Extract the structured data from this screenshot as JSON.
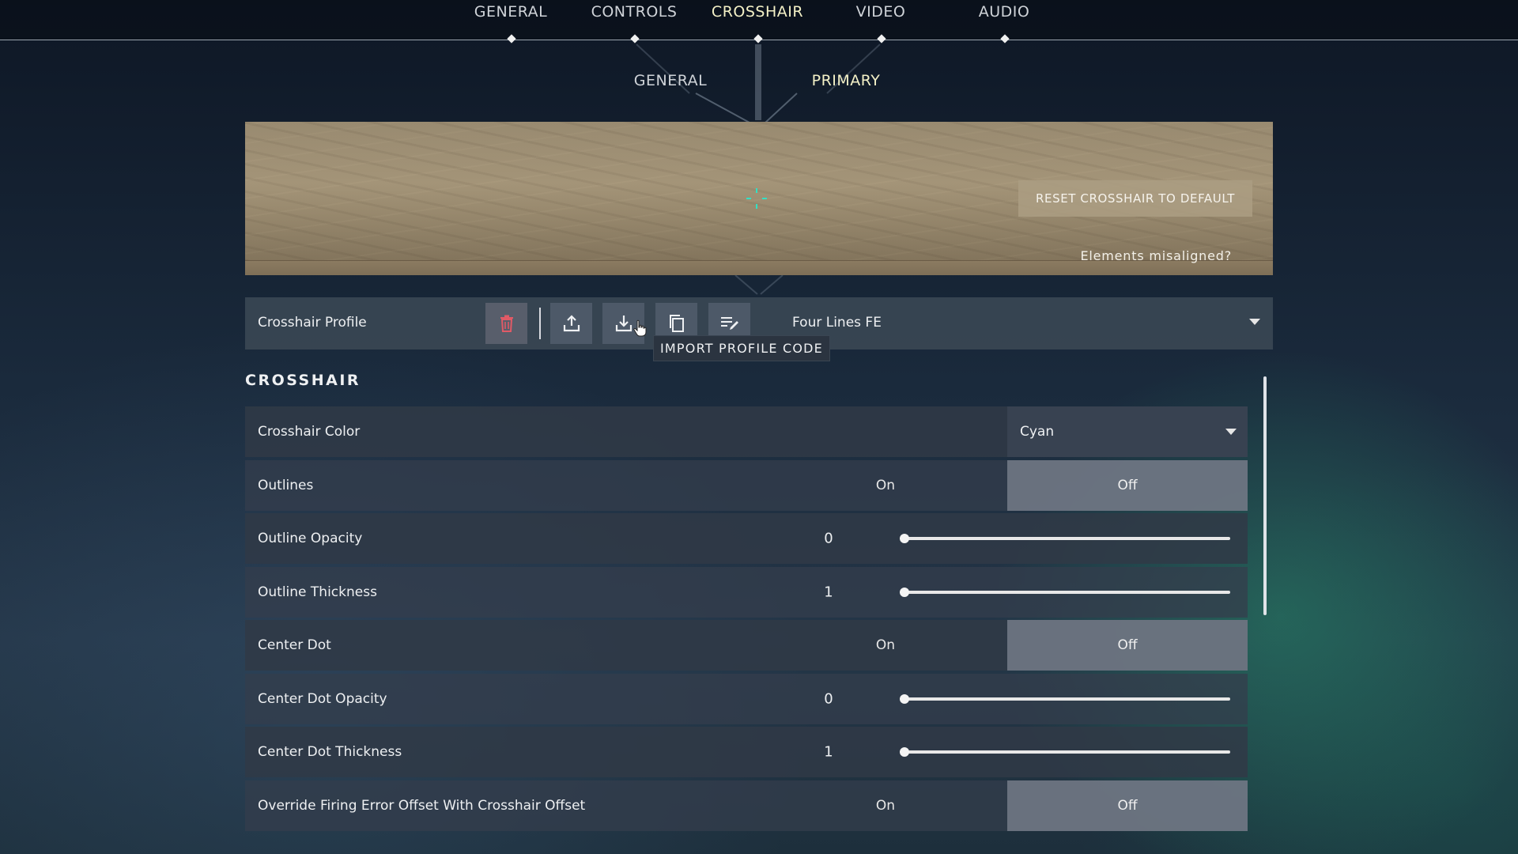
{
  "nav": {
    "tabs": [
      {
        "label": "GENERAL",
        "active": false
      },
      {
        "label": "CONTROLS",
        "active": false
      },
      {
        "label": "CROSSHAIR",
        "active": true
      },
      {
        "label": "VIDEO",
        "active": false
      },
      {
        "label": "AUDIO",
        "active": false
      }
    ]
  },
  "subnav": {
    "tabs": [
      {
        "label": "GENERAL",
        "active": false
      },
      {
        "label": "PRIMARY",
        "active": true
      }
    ]
  },
  "preview": {
    "reset_label": "RESET CROSSHAIR TO DEFAULT",
    "misaligned_label": "Elements misaligned?",
    "crosshair_color": "#32e0c4"
  },
  "profile": {
    "label": "Crosshair Profile",
    "selected": "Four Lines FE",
    "tooltip": "IMPORT PROFILE CODE",
    "icons": [
      "trash-icon",
      "upload-icon",
      "download-icon",
      "copy-icon",
      "rename-icon"
    ]
  },
  "crosshair": {
    "section_title": "CROSSHAIR",
    "rows": [
      {
        "label": "Crosshair Color",
        "type": "dropdown",
        "value": "Cyan"
      },
      {
        "label": "Outlines",
        "type": "toggle",
        "on_label": "On",
        "off_label": "Off",
        "selected": "Off"
      },
      {
        "label": "Outline Opacity",
        "type": "slider",
        "value": "0",
        "fraction": 0
      },
      {
        "label": "Outline Thickness",
        "type": "slider",
        "value": "1",
        "fraction": 0
      },
      {
        "label": "Center Dot",
        "type": "toggle",
        "on_label": "On",
        "off_label": "Off",
        "selected": "Off"
      },
      {
        "label": "Center Dot Opacity",
        "type": "slider",
        "value": "0",
        "fraction": 0
      },
      {
        "label": "Center Dot Thickness",
        "type": "slider",
        "value": "1",
        "fraction": 0
      },
      {
        "label": "Override Firing Error Offset With Crosshair Offset",
        "type": "toggle",
        "on_label": "On",
        "off_label": "Off",
        "selected": "Off"
      }
    ]
  },
  "colors": {
    "accent_active": "#f4f1c7",
    "delete_icon": "#e05a66"
  }
}
